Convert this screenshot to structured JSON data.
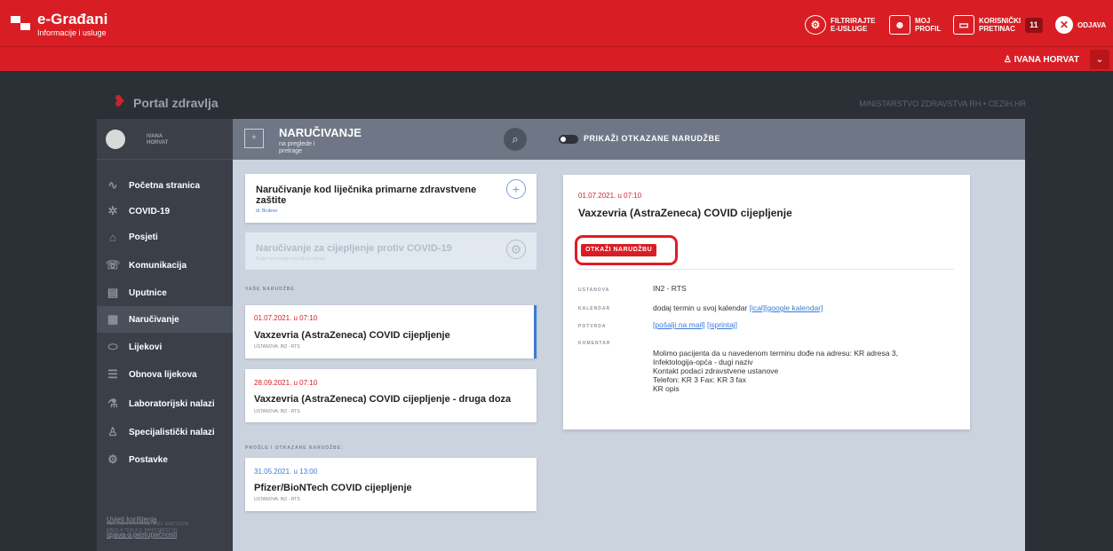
{
  "topbar": {
    "app_title": "e-Građani",
    "app_subtitle": "Informacije i usluge",
    "filter_label_1": "FILTRIRAJTE",
    "filter_label_2": "E-USLUGE",
    "profile_label_1": "MOJ",
    "profile_label_2": "PROFIL",
    "inbox_label_1": "KORISNIČKI",
    "inbox_label_2": "PRETINAC",
    "inbox_count": "11",
    "logout_label": "ODJAVA"
  },
  "userbar": {
    "user_name": "IVANA HORVAT",
    "user_icon": "person-icon"
  },
  "portal": {
    "name": "Portal zdravlja",
    "ministry": "MINISTARSTVO ZDRAVSTVA RH • CEZIH.HR"
  },
  "sidebar": {
    "profile_first": "IVANA",
    "profile_last": "HORVAT",
    "items": [
      {
        "label": "Početna stranica",
        "icon": "pulse-icon"
      },
      {
        "label": "COVID-19",
        "icon": "virus-icon"
      },
      {
        "label": "Posjeti",
        "icon": "house-icon"
      },
      {
        "label": "Komunikacija",
        "icon": "chat-icon"
      },
      {
        "label": "Uputnice",
        "icon": "document-icon"
      },
      {
        "label": "Naručivanje",
        "icon": "calendar-icon"
      },
      {
        "label": "Lijekovi",
        "icon": "pill-icon"
      },
      {
        "label": "Obnova lijekova",
        "icon": "prescription-icon"
      },
      {
        "label": "Laboratorijski nalazi",
        "icon": "lab-icon"
      },
      {
        "label": "Specijalistički nalazi",
        "icon": "specialist-icon"
      },
      {
        "label": "Postavke",
        "icon": "gear-icon"
      }
    ],
    "active_index": 5,
    "footer_link_1": "Uvjeti korištenja",
    "footer_link_2": "Izjava o pristupačnosti",
    "footer_small": "VERZIJA 5.2.0 LIPANJ 2021. ERICSSON NIKOLA TESLA D. MINISTARSTVO ZDRAVSTVA RH"
  },
  "middle": {
    "title": "NARUČIVANJE",
    "subtitle": "na preglede i pretrage",
    "primary_card": {
      "title": "Naručivanje kod liječnika primarne zdravstvene zaštite",
      "doctor": "dr. Brukner"
    },
    "covid_card": {
      "title": "Naručivanje za cijepljenje protiv COVID-19",
      "subtitle": "Radje se morajte naručiti za mjesto"
    },
    "section_mine": "VAŠE NARUDŽBE",
    "section_past": "PROŠLE I OTKAZANE NARUDŽBE:",
    "appointments": [
      {
        "date": "01.07.2021. u 07:10",
        "title": "Vaxzevria (AstraZeneca) COVID cijepljenje",
        "institution": "USTANOVA: IN2 - RTS"
      },
      {
        "date": "28.09.2021. u 07:10",
        "title": "Vaxzevria (AstraZeneca) COVID cijepljenje - druga doza",
        "institution": "USTANOVA: IN2 - RTS"
      }
    ],
    "past": [
      {
        "date": "31.05.2021. u 13:00",
        "title": "Pfizer/BioNTech COVID cijepljenje",
        "institution": "USTANOVA: IN2 - RTS"
      }
    ]
  },
  "right": {
    "toggle_label": "PRIKAŽI OTKAZANE NARUDŽBE",
    "detail": {
      "date": "01.07.2021. u 07:10",
      "title": "Vaxzevria (AstraZeneca) COVID cijepljenje",
      "cancel_label": "OTKAŽI NARUDŽBU",
      "institution_label": "USTANOVA",
      "institution_value": "IN2 - RTS",
      "calendar_label": "KALENDAR",
      "calendar_text": "dodaj termin u svoj kalendar",
      "calendar_link_1": "[ical]",
      "calendar_link_2": "[google kalendar]",
      "confirm_label": "POTVRDA",
      "confirm_link_1": "[pošalji na mail]",
      "confirm_link_2": "[isprintaj]",
      "comment_label": "KOMENTAR",
      "comment_lines": [
        "Molimo pacijenta da u navedenom terminu dođe na adresu: KR adresa 3,",
        "Infektologija-opća - dugi naziv",
        "Kontakt podaci zdravstvene ustanove",
        "Telefon: KR 3 Fax: KR 3 fax",
        "KR opis"
      ]
    }
  },
  "colors": {
    "brand_red": "#d81e24",
    "link_blue": "#3a7bd5",
    "sidebar": "#3a3f48"
  }
}
